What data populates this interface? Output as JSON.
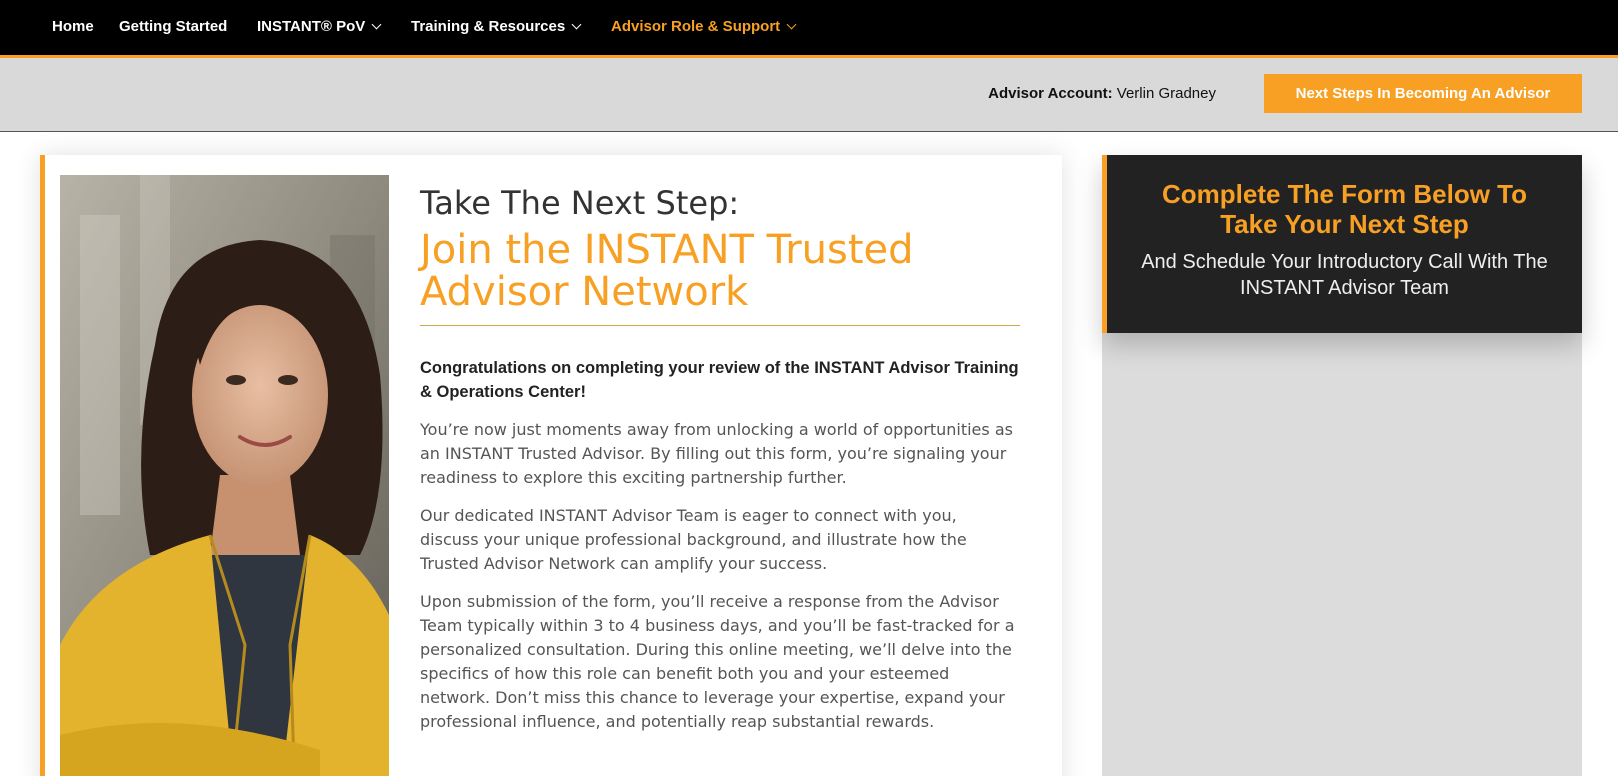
{
  "nav": {
    "items": [
      {
        "label": "Home",
        "dropdown": false
      },
      {
        "label": "Getting Started",
        "dropdown": false
      },
      {
        "label": "INSTANT® PoV",
        "dropdown": true
      },
      {
        "label": "Training & Resources",
        "dropdown": true
      },
      {
        "label": "Advisor Role & Support",
        "dropdown": true,
        "active": true
      }
    ]
  },
  "account": {
    "label": "Advisor Account:",
    "name": "Verlin Gradney",
    "cta_label": "Next Steps In Becoming An Advisor"
  },
  "main": {
    "heading_small": "Take The Next Step:",
    "heading_big": "Join the INSTANT Trusted Advisor Network",
    "lead": "Congratulations on completing your review of the INSTANT Advisor Training & Operations Center!",
    "paragraphs": [
      "You’re now just moments away from unlocking a world of opportunities as an INSTANT Trusted Advisor. By filling out this form, you’re signaling your readiness to explore this exciting partnership further.",
      "Our dedicated INSTANT Advisor Team is eager to connect with you, discuss your unique professional background, and illustrate how the Trusted Advisor Network can amplify your success.",
      "Upon submission of the form, you’ll receive a response from the Advisor Team typically within 3 to 4 business days, and you’ll be fast-tracked for a personalized consultation. During this online meeting, we’ll delve into the specifics of how this role can benefit both you and your esteemed network. Don’t miss this chance to leverage your expertise, expand your professional influence, and potentially reap substantial rewards."
    ]
  },
  "side": {
    "title": "Complete The Form Below To Take Your Next Step",
    "subtitle": "And Schedule Your Introductory Call With The INSTANT Advisor Team"
  },
  "colors": {
    "accent": "#f7a023",
    "nav_bg": "#000000",
    "account_bar_bg": "#d9d9d9",
    "side_header_bg": "#222222"
  }
}
